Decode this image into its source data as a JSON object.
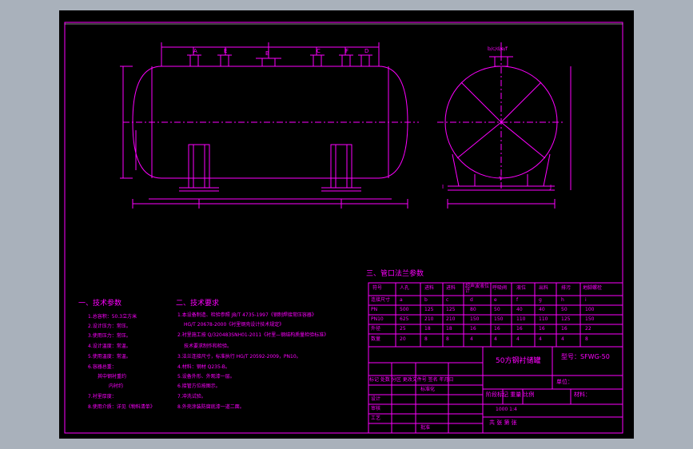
{
  "colors": {
    "background": "#a9b1bb",
    "sheet": "#000000",
    "line": "#ff00ff",
    "accent_white": "#ffffff"
  },
  "views": {
    "front_nozzle_labels": [
      "A",
      "E",
      "B",
      "C",
      "F",
      "D"
    ],
    "side_nozzle_labels": [
      "b/c/d/e/f"
    ],
    "side_misc": [
      "I",
      "J",
      "T"
    ]
  },
  "sections": {
    "tech_params_title": "一、技术参数",
    "tech_reqs_title": "二、技术要求",
    "nozzle_table_title": "三、管口法兰参数"
  },
  "tech_params": [
    "1.总容积：50.3立方米",
    "2.设计压力：常压。",
    "3.使用压力：常压。",
    "4.设计温度：常温。",
    "5.使用温度：常温。",
    "6.容器总重：",
    "其中钢衬重约",
    "内衬约",
    "7.衬里厚度：",
    "8.使用介质：详见《物料清单》"
  ],
  "tech_reqs": [
    "1.本设备制造、检验参照 JB/T 4735-1997《钢制焊接常压容器》",
    "HG/T 20678-2000《衬里钢壳设计技术规定》",
    "2.衬里施工按 Q/320483SNH01-2011《衬里—钢结构质量检验标准》",
    "技术要求制作和检验。",
    "3.法兰连接尺寸，标准执行 HG/T 20592-2009，PN10。",
    "4.材料：钢材 Q235-B。",
    "5.设备外形、外观漆一层。",
    "6.接管方位按图示。",
    "7.冲洗试验。",
    "8.外壳涂装防腐底漆一道二面。"
  ],
  "nozzle_table": {
    "headers": [
      "符号",
      "人孔",
      "进料",
      "进料",
      "超声波液位计",
      "呼吸阀",
      "液位",
      "出料",
      "排污",
      "地脚螺栓"
    ],
    "row_labels": [
      "连接尺寸",
      "PN",
      "PN10",
      "外径",
      "数量"
    ],
    "rows": [
      [
        "a",
        "b",
        "c",
        "d",
        "e",
        "f",
        "g",
        "h",
        "i"
      ],
      [
        "500",
        "125",
        "125",
        "80",
        "50",
        "40",
        "40",
        "50",
        "100"
      ],
      [
        "625",
        "210",
        "210",
        "150",
        "150",
        "110",
        "110",
        "125",
        "150"
      ],
      [
        "25",
        "18",
        "18",
        "16",
        "16",
        "16",
        "16",
        "16",
        "22"
      ],
      [
        "20",
        "8",
        "8",
        "4",
        "4",
        "4",
        "4",
        "4",
        "8"
      ]
    ]
  },
  "title_block": {
    "title": "50方钢衬储罐",
    "drawing_no": "型号：SFWG-50",
    "unit_label": "单位：",
    "header_row": "标记 处数 分区 更改文件号 签名 年月日",
    "stage_row": "阶段标记 重量 比例",
    "material_label": "材料：",
    "sheet_label": "共  张  第  张",
    "designer": "设计",
    "checker": "审核",
    "approver": "批准",
    "process": "工艺",
    "standard": "标准化",
    "scale_values": "1000   1:4"
  }
}
